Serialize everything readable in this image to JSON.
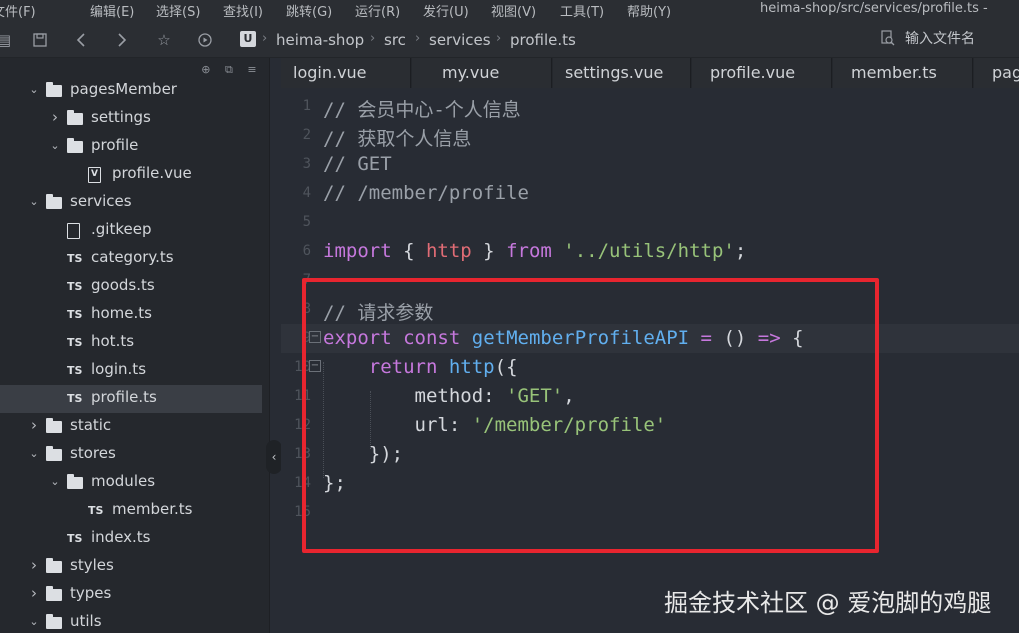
{
  "menubar": {
    "items": [
      "文件(F)",
      "编辑(E)",
      "选择(S)",
      "查找(I)",
      "跳转(G)",
      "运行(R)",
      "发行(U)",
      "视图(V)",
      "工具(T)",
      "帮助(Y)"
    ],
    "window_title": "heima-shop/src/services/profile.ts -"
  },
  "toolbar": {
    "project_badge": "U",
    "breadcrumb": [
      "heima-shop",
      "src",
      "services",
      "profile.ts"
    ],
    "search_placeholder": "输入文件名"
  },
  "sidebar": {
    "tree": [
      {
        "label": "pagesMember",
        "type": "folder",
        "expanded": true,
        "depth": 0
      },
      {
        "label": "settings",
        "type": "folder",
        "expanded": false,
        "depth": 1
      },
      {
        "label": "profile",
        "type": "folder",
        "expanded": true,
        "depth": 1
      },
      {
        "label": "profile.vue",
        "type": "vue",
        "depth": 2
      },
      {
        "label": "services",
        "type": "folder",
        "expanded": true,
        "depth": 0
      },
      {
        "label": ".gitkeep",
        "type": "file",
        "depth": 1
      },
      {
        "label": "category.ts",
        "type": "ts",
        "depth": 1
      },
      {
        "label": "goods.ts",
        "type": "ts",
        "depth": 1
      },
      {
        "label": "home.ts",
        "type": "ts",
        "depth": 1
      },
      {
        "label": "hot.ts",
        "type": "ts",
        "depth": 1
      },
      {
        "label": "login.ts",
        "type": "ts",
        "depth": 1
      },
      {
        "label": "profile.ts",
        "type": "ts",
        "depth": 1,
        "selected": true
      },
      {
        "label": "static",
        "type": "folder",
        "expanded": false,
        "depth": 0
      },
      {
        "label": "stores",
        "type": "folder",
        "expanded": true,
        "depth": 0
      },
      {
        "label": "modules",
        "type": "folder",
        "expanded": true,
        "depth": 1
      },
      {
        "label": "member.ts",
        "type": "ts",
        "depth": 2
      },
      {
        "label": "index.ts",
        "type": "ts",
        "depth": 1
      },
      {
        "label": "styles",
        "type": "folder",
        "expanded": false,
        "depth": 0
      },
      {
        "label": "types",
        "type": "folder",
        "expanded": false,
        "depth": 0
      },
      {
        "label": "utils",
        "type": "folder",
        "expanded": true,
        "depth": 0
      }
    ],
    "ts_badge": "TS",
    "vue_badge": "V"
  },
  "tabs": [
    "login.vue",
    "my.vue",
    "settings.vue",
    "profile.vue",
    "member.ts",
    "pag"
  ],
  "editor": {
    "current_line": 9,
    "lines": [
      {
        "n": "1",
        "tokens": [
          [
            "c-comment",
            "// 会员中心-个人信息"
          ]
        ]
      },
      {
        "n": "2",
        "tokens": [
          [
            "c-comment",
            "// 获取个人信息"
          ]
        ]
      },
      {
        "n": "3",
        "tokens": [
          [
            "c-comment",
            "// GET"
          ]
        ]
      },
      {
        "n": "4",
        "tokens": [
          [
            "c-comment",
            "// /member/profile"
          ]
        ]
      },
      {
        "n": "5",
        "tokens": []
      },
      {
        "n": "6",
        "tokens": [
          [
            "c-kw",
            "import"
          ],
          [
            "c-punc",
            " { "
          ],
          [
            "c-http",
            "http"
          ],
          [
            "c-punc",
            " } "
          ],
          [
            "c-kw",
            "from"
          ],
          [
            "c-punc",
            " "
          ],
          [
            "c-str",
            "'../utils/http'"
          ],
          [
            "c-punc",
            ";"
          ]
        ]
      },
      {
        "n": "7",
        "tokens": []
      },
      {
        "n": "8",
        "tokens": [
          [
            "c-comment",
            "// 请求参数"
          ]
        ]
      },
      {
        "n": "9",
        "fold": true,
        "tokens": [
          [
            "c-kw",
            "export"
          ],
          [
            "c-punc",
            " "
          ],
          [
            "c-kw",
            "const"
          ],
          [
            "c-punc",
            " "
          ],
          [
            "c-fn",
            "getMemberProfileAPI"
          ],
          [
            "c-punc",
            " "
          ],
          [
            "c-kw",
            "="
          ],
          [
            "c-punc",
            " () "
          ],
          [
            "c-kw",
            "=>"
          ],
          [
            "c-punc",
            " {"
          ]
        ]
      },
      {
        "n": "10",
        "fold": true,
        "tokens": [
          [
            "c-punc",
            "    "
          ],
          [
            "c-kw",
            "return"
          ],
          [
            "c-punc",
            " "
          ],
          [
            "c-fn",
            "http"
          ],
          [
            "c-punc",
            "({"
          ]
        ]
      },
      {
        "n": "11",
        "tokens": [
          [
            "c-punc",
            "        "
          ],
          [
            "c-prop",
            "method"
          ],
          [
            "c-punc",
            ": "
          ],
          [
            "c-str",
            "'GET'"
          ],
          [
            "c-punc",
            ","
          ]
        ]
      },
      {
        "n": "12",
        "tokens": [
          [
            "c-punc",
            "        "
          ],
          [
            "c-prop",
            "url"
          ],
          [
            "c-punc",
            ": "
          ],
          [
            "c-str",
            "'/member/profile'"
          ]
        ]
      },
      {
        "n": "13",
        "tokens": [
          [
            "c-punc",
            "    });"
          ]
        ]
      },
      {
        "n": "14",
        "tokens": [
          [
            "c-punc",
            "};"
          ]
        ]
      },
      {
        "n": "15",
        "tokens": []
      }
    ]
  },
  "watermark": "掘金技术社区 @ 爱泡脚的鸡腿",
  "colors": {
    "highlight_box": "#e8252f",
    "keyword": "#c678dd",
    "function": "#61afef",
    "string": "#98c379",
    "import_name": "#e06c75"
  }
}
